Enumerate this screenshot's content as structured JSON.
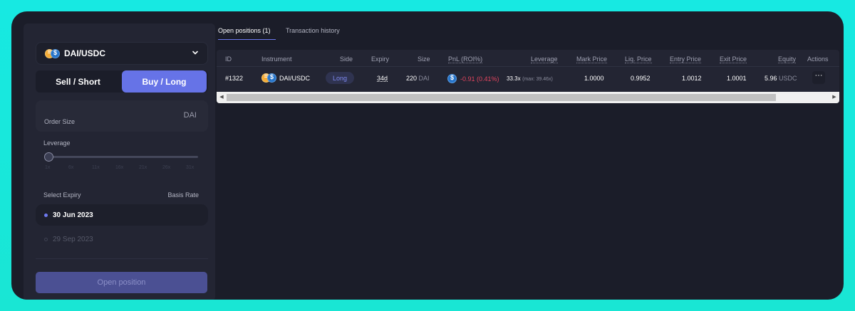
{
  "pair_select": {
    "label": "DAI/USDC",
    "icons": [
      "dai-coin-icon",
      "usdc-coin-icon"
    ]
  },
  "side": {
    "sell": "Sell / Short",
    "buy": "Buy / Long",
    "selected": "buy"
  },
  "order_size": {
    "label": "Order Size",
    "unit": "DAI",
    "value": ""
  },
  "leverage": {
    "label": "Leverage",
    "ticks": [
      "1x",
      "6x",
      "11x",
      "16x",
      "21x",
      "26x",
      "31x"
    ],
    "value_fraction": 0
  },
  "expiry": {
    "label": "Select Expiry",
    "basis_label": "Basis Rate",
    "options": [
      "30 Jun 2023",
      "29 Sep 2023"
    ],
    "selected": 0
  },
  "open_button": "Open position",
  "tabs": {
    "open_positions": "Open positions (1)",
    "history": "Transaction history"
  },
  "table": {
    "headers": {
      "id": "ID",
      "instrument": "Instrument",
      "side": "Side",
      "expiry": "Expiry",
      "size": "Size",
      "pnl": "PnL (ROI%)",
      "leverage": "Leverage",
      "mark_price": "Mark Price",
      "liq_price": "Liq. Price",
      "entry_price": "Entry Price",
      "exit_price": "Exit Price",
      "equity": "Equity",
      "actions": "Actions"
    },
    "rows": [
      {
        "id": "#1322",
        "instrument": "DAI/USDC",
        "side": "Long",
        "expiry": "34d",
        "size": "220",
        "size_unit": "DAI",
        "pnl": "-0.91 (0.41%)",
        "leverage": "33.3x",
        "leverage_max": "(max: 39.46x)",
        "mark_price": "1.0000",
        "liq_price": "0.9952",
        "entry_price": "1.0012",
        "exit_price": "1.0001",
        "equity": "5.96",
        "equity_unit": "USDC",
        "actions": "···"
      }
    ]
  },
  "colors": {
    "accent": "#6673e7",
    "negative": "#e0445e",
    "background": "#1b1d29",
    "outer": "#17e9e2"
  }
}
